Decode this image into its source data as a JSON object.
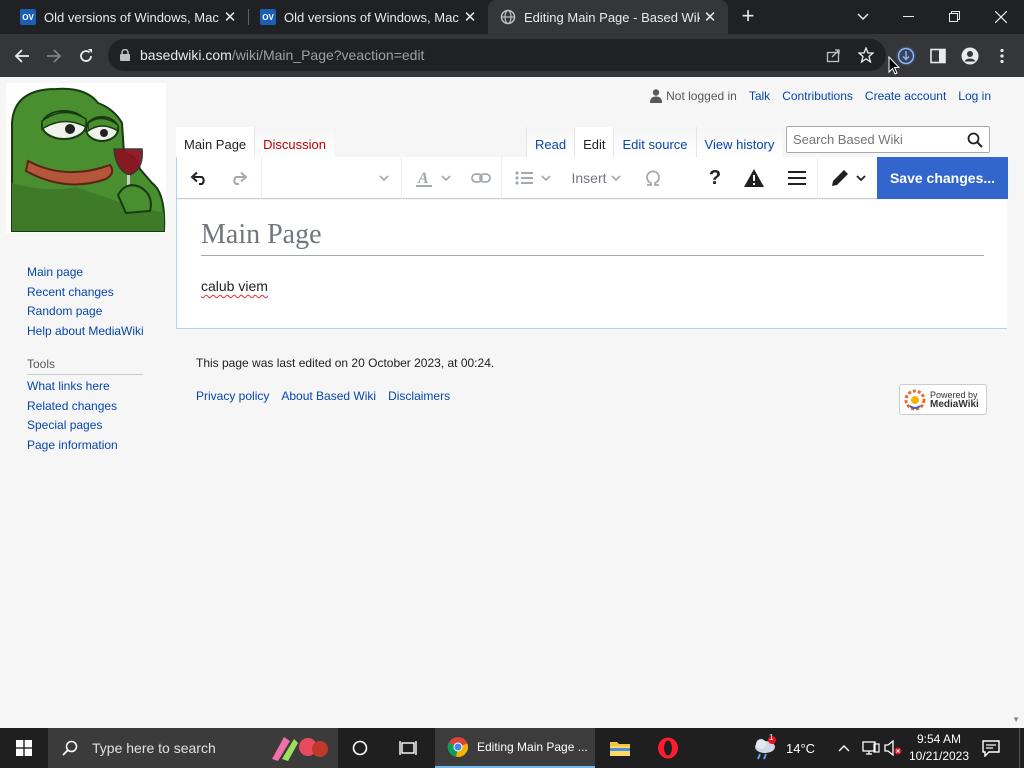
{
  "browser": {
    "tabs": [
      {
        "title": "Old versions of Windows, Mac a",
        "favicon": "OV"
      },
      {
        "title": "Old versions of Windows, Mac a",
        "favicon": "OV"
      },
      {
        "title": "Editing Main Page - Based Wiki",
        "favicon": "globe-icon"
      }
    ],
    "url_host": "basedwiki.com",
    "url_rest": "/wiki/Main_Page?veaction=edit"
  },
  "personal": {
    "not_logged_in": "Not logged in",
    "talk": "Talk",
    "contributions": "Contributions",
    "create_account": "Create account",
    "log_in": "Log in"
  },
  "page_tabs": {
    "main_page": "Main Page",
    "discussion": "Discussion",
    "read": "Read",
    "edit": "Edit",
    "edit_source": "Edit source",
    "view_history": "View history"
  },
  "search": {
    "placeholder": "Search Based Wiki"
  },
  "editor": {
    "insert_label": "Insert",
    "help_label": "?",
    "save_label": "Save changes...",
    "page_title": "Main Page",
    "body_text": "calub viem"
  },
  "sidebar": {
    "nav": [
      "Main page",
      "Recent changes",
      "Random page",
      "Help about MediaWiki"
    ],
    "tools_heading": "Tools",
    "tools": [
      "What links here",
      "Related changes",
      "Special pages",
      "Page information"
    ]
  },
  "footer": {
    "last_edited": "This page was last edited on 20 October 2023, at 00:24.",
    "links": [
      "Privacy policy",
      "About Based Wiki",
      "Disclaimers"
    ],
    "powered_line1": "Powered by",
    "powered_line2": "MediaWiki"
  },
  "taskbar": {
    "search_placeholder": "Type here to search",
    "active_app": "Editing Main Page ...",
    "weather": "14°C",
    "notification_badge": "1",
    "time": "9:54 AM",
    "date": "10/21/2023"
  },
  "colors": {
    "link": "#0645ad",
    "redlink": "#ba0000",
    "progressive": "#3366cc",
    "chrome_dark": "#202124"
  }
}
